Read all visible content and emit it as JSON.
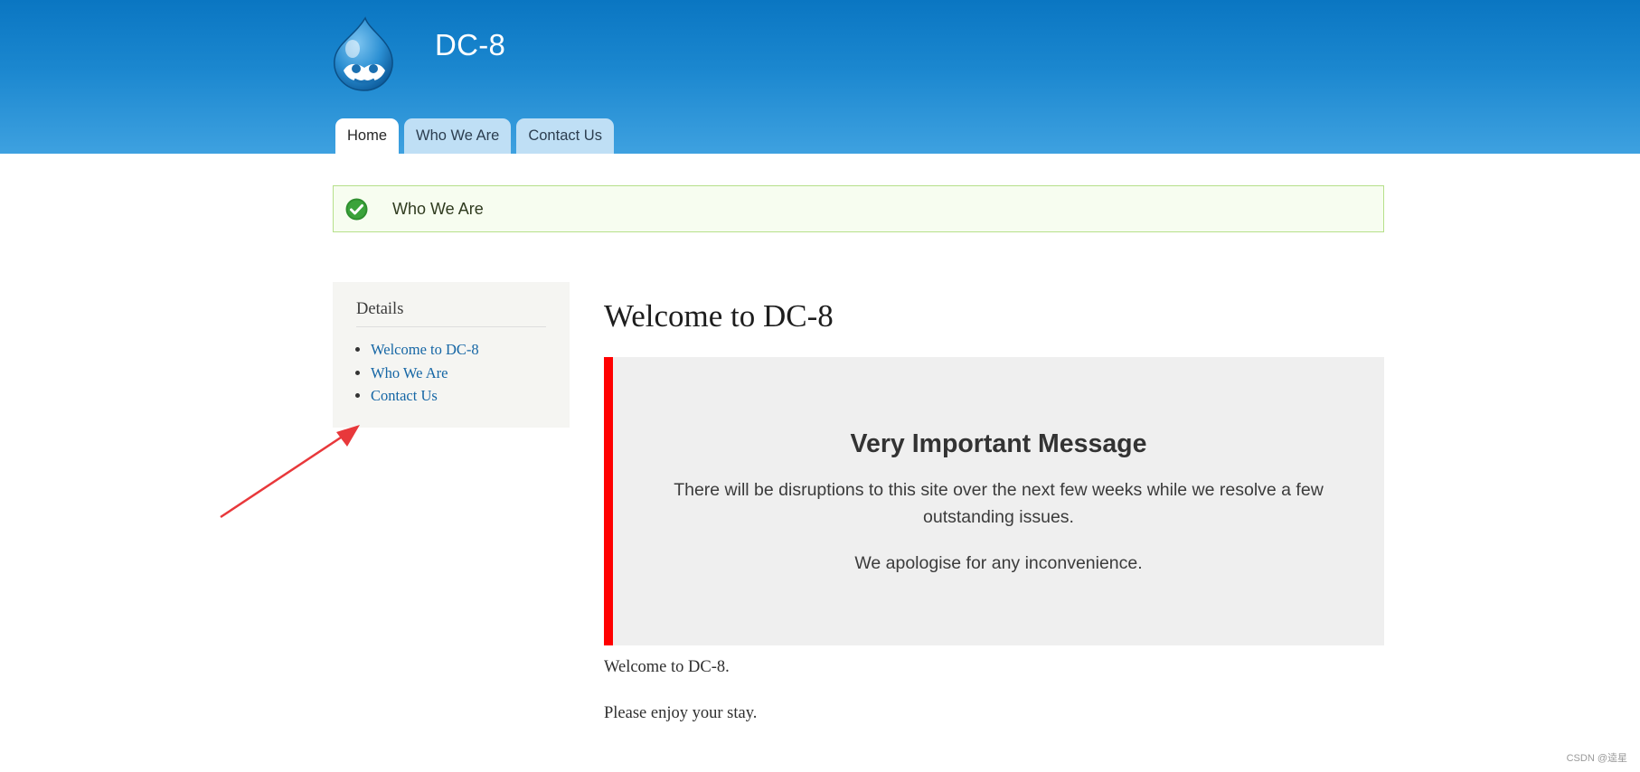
{
  "site": {
    "name": "DC-8",
    "logo_icon": "drupal-drop-icon"
  },
  "nav": {
    "tabs": [
      {
        "label": "Home",
        "active": true
      },
      {
        "label": "Who We Are",
        "active": false
      },
      {
        "label": "Contact Us",
        "active": false
      }
    ]
  },
  "status": {
    "icon": "check-circle-icon",
    "text": "Who We Are"
  },
  "sidebar": {
    "title": "Details",
    "links": [
      {
        "label": "Welcome to DC-8"
      },
      {
        "label": "Who We Are"
      },
      {
        "label": "Contact Us"
      }
    ]
  },
  "main": {
    "title": "Welcome to DC-8",
    "notice": {
      "title": "Very Important Message",
      "text": "There will be disruptions to this site over the next few weeks while we resolve a few outstanding issues.",
      "text2": "We apologise for any inconvenience."
    },
    "paragraphs": [
      "Welcome to DC-8.",
      "Please enjoy your stay."
    ]
  },
  "watermark": "CSDN @逵星",
  "colors": {
    "header_top": "#0a76c2",
    "header_bottom": "#3ea1e0",
    "tab_bg": "#bfdff5",
    "link": "#1566a5",
    "notice_border": "#ff0000",
    "status_border": "#b6e08a",
    "arrow": "#e8383b"
  }
}
